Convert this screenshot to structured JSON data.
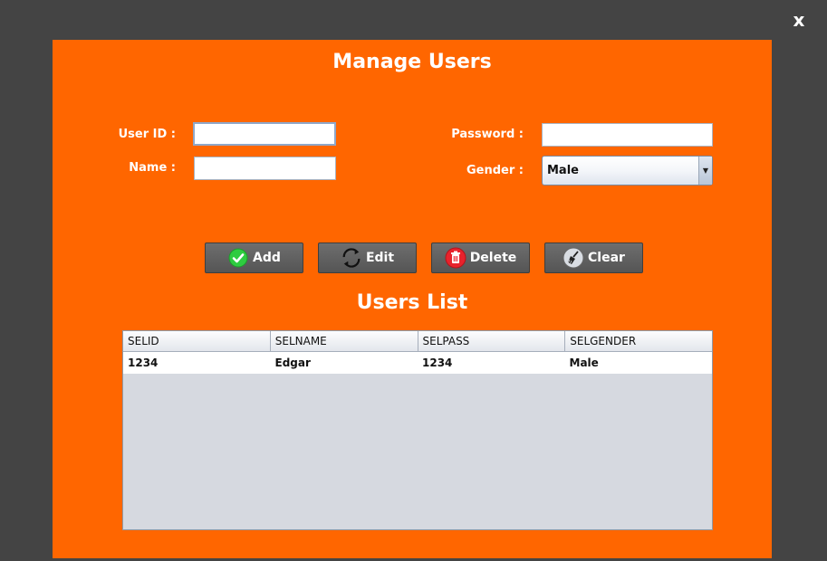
{
  "window": {
    "close_label": "x",
    "background": "#444444"
  },
  "panel": {
    "accent": "#ff6600"
  },
  "page_title": "Manage Users",
  "form": {
    "user_id_label": "User ID :",
    "user_id_value": "",
    "name_label": "Name :",
    "name_value": "",
    "password_label": "Password :",
    "password_value": "",
    "gender_label": "Gender :",
    "gender_value": "Male"
  },
  "buttons": {
    "add": {
      "label": "Add",
      "icon": "check-circle-icon",
      "color": "#2ecc40"
    },
    "edit": {
      "label": "Edit",
      "icon": "refresh-icon"
    },
    "delete": {
      "label": "Delete",
      "icon": "trash-icon",
      "color": "#e8222c"
    },
    "clear": {
      "label": "Clear",
      "icon": "broom-icon"
    }
  },
  "list_title": "Users List",
  "table": {
    "columns": [
      "SELID",
      "SELNAME",
      "SELPASS",
      "SELGENDER"
    ],
    "rows": [
      [
        "1234",
        "Edgar",
        "1234",
        "Male"
      ]
    ]
  }
}
